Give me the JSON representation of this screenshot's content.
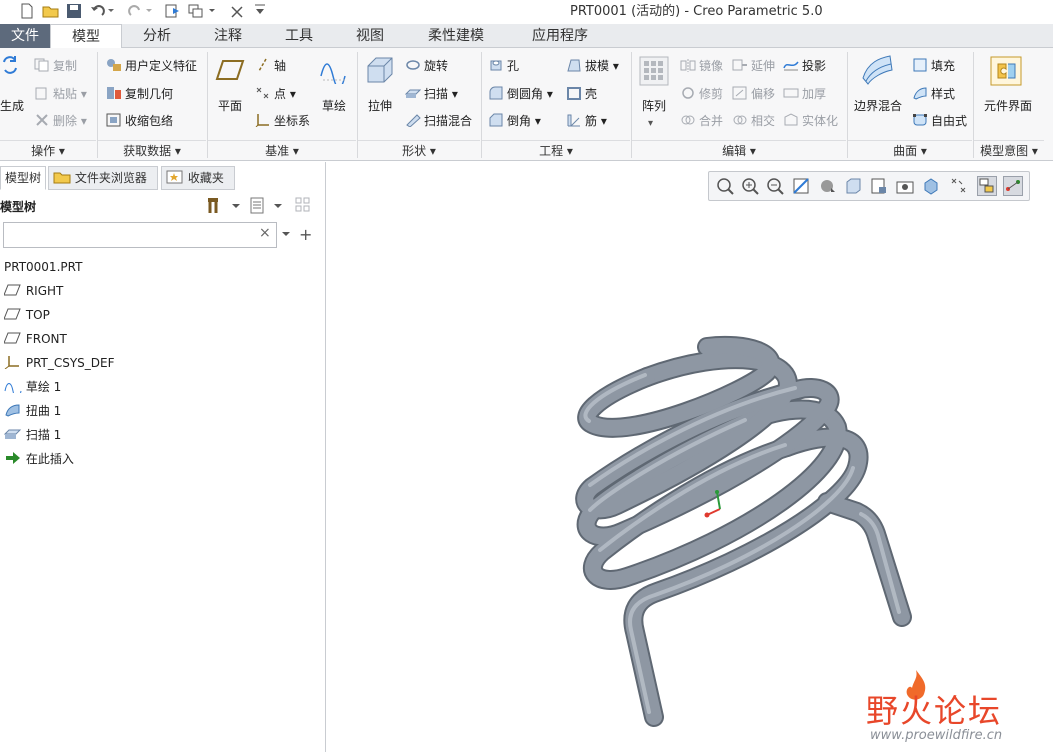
{
  "window": {
    "title": "PRT0001 (活动的) - Creo Parametric 5.0"
  },
  "quick_access": [
    "new-icon",
    "open-icon",
    "save-icon",
    "undo-icon",
    "redo-icon",
    "regenerate-icon",
    "windows-icon",
    "close-icon",
    "customize-icon"
  ],
  "tabs": [
    {
      "label": "文件"
    },
    {
      "label": "模型"
    },
    {
      "label": "分析"
    },
    {
      "label": "注释"
    },
    {
      "label": "工具"
    },
    {
      "label": "视图"
    },
    {
      "label": "柔性建模"
    },
    {
      "label": "应用程序"
    }
  ],
  "ribbon": {
    "operations": {
      "regen": "生成",
      "copy": "复制",
      "paste": "粘贴",
      "delete": "删除",
      "footer": "操作"
    },
    "get_data": {
      "udf": "用户定义特征",
      "copy_geom": "复制几何",
      "shrinkwrap": "收缩包络",
      "footer": "获取数据"
    },
    "datum": {
      "plane": "平面",
      "axis": "轴",
      "point": "点",
      "csys": "坐标系",
      "sketch": "草绘",
      "footer": "基准"
    },
    "shapes": {
      "extrude": "拉伸",
      "revolve": "旋转",
      "sweep": "扫描",
      "swept_blend": "扫描混合",
      "footer": "形状"
    },
    "engineering": {
      "hole": "孔",
      "round": "倒圆角",
      "chamfer": "倒角",
      "draft": "拔模",
      "shell": "壳",
      "rib": "筋",
      "footer": "工程"
    },
    "editing": {
      "pattern": "阵列",
      "mirror": "镜像",
      "trim": "修剪",
      "merge": "合并",
      "extend": "延伸",
      "offset": "偏移",
      "intersect": "相交",
      "project": "投影",
      "thicken": "加厚",
      "solidify": "实体化",
      "footer": "编辑"
    },
    "surfaces": {
      "boundary_blend": "边界混合",
      "fill": "填充",
      "style": "样式",
      "freeform": "自由式",
      "footer": "曲面"
    },
    "model_intent": {
      "component_interface": "元件界面",
      "footer": "模型意图"
    }
  },
  "panel": {
    "tabs": [
      "模型树",
      "文件夹浏览器",
      "收藏夹"
    ],
    "header": "模型树",
    "search_value": "",
    "tree": [
      {
        "label": "PRT0001.PRT",
        "icon": "none"
      },
      {
        "label": "RIGHT",
        "icon": "datum-plane-icon"
      },
      {
        "label": "TOP",
        "icon": "datum-plane-icon"
      },
      {
        "label": "FRONT",
        "icon": "datum-plane-icon"
      },
      {
        "label": "PRT_CSYS_DEF",
        "icon": "csys-icon"
      },
      {
        "label": "草绘 1",
        "icon": "sketch-icon"
      },
      {
        "label": "扭曲 1",
        "icon": "warp-icon"
      },
      {
        "label": "扫描 1",
        "icon": "sweep-icon"
      },
      {
        "label": "在此插入",
        "icon": "insert-arrow-icon"
      }
    ]
  },
  "view_toolbar": [
    "refit-icon",
    "zoom-in-icon",
    "zoom-out-icon",
    "repaint-icon",
    "display-style-icon",
    "saved-views-icon",
    "view-manager-icon",
    "perspective-icon",
    "appearance-icon",
    "datum-display-icon",
    "annotation-display-icon",
    "spin-center-icon"
  ],
  "watermark": {
    "brand": "野火论坛",
    "url": "www.proewildfire.cn"
  },
  "colors": {
    "file_tab": "#5d6a7c",
    "model_gray": "#8e97a3",
    "brand_red": "#e8472a"
  }
}
